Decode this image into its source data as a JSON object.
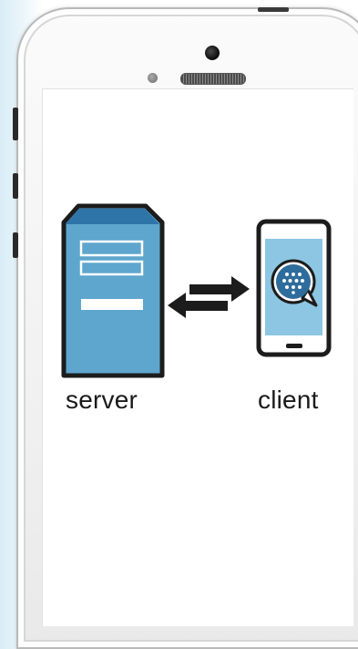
{
  "diagram": {
    "server_label": "server",
    "client_label": "client"
  },
  "colors": {
    "outline": "#1c1c1c",
    "server_top": "#2f74a9",
    "server_body": "#5ea6cd",
    "client_screen": "#8cc6e2",
    "bubble": "#2e6c9c"
  },
  "icons": [
    "server-icon",
    "smartphone-icon",
    "bidirectional-arrows-icon",
    "chat-bubble-icon"
  ]
}
